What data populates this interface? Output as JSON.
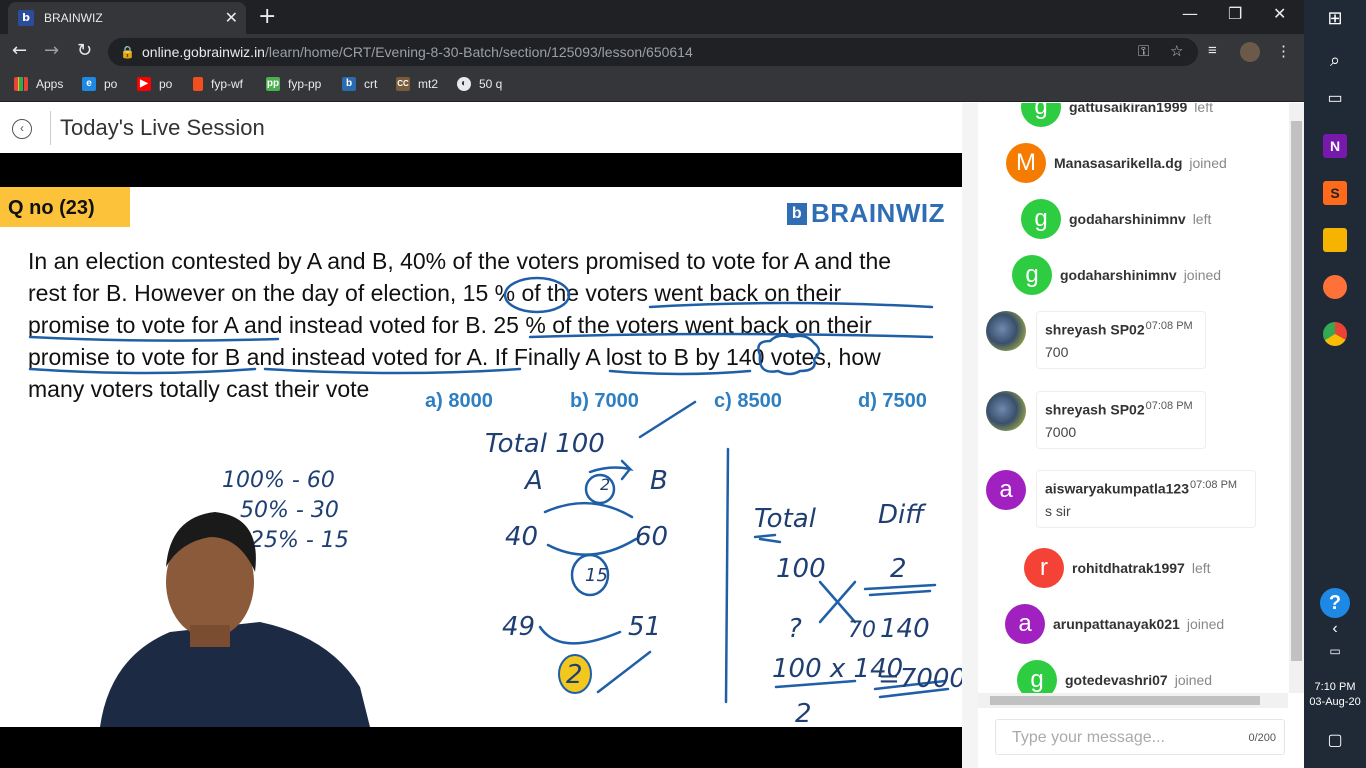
{
  "browser": {
    "tab_title": "BRAINWIZ",
    "tab_favicon": "b",
    "url_domain": "online.gobrainwiz.in",
    "url_path": "/learn/home/CRT/Evening-8-30-Batch/section/125093/lesson/650614"
  },
  "bookmarks": [
    {
      "label": "Apps",
      "icon": "apps-grid-icon",
      "color": "#e8eaed"
    },
    {
      "label": "po",
      "icon": "edge-icon",
      "color": "#1e88e5"
    },
    {
      "label": "po",
      "icon": "youtube-icon",
      "color": "#ff0000"
    },
    {
      "label": "fyp-wf",
      "icon": "figma-icon",
      "color": "#f24e1e"
    },
    {
      "label": "fyp-pp",
      "icon": "pp-icon",
      "color": "#4caf50"
    },
    {
      "label": "crt",
      "icon": "brainwiz-icon",
      "color": "#2b6cb0"
    },
    {
      "label": "mt2",
      "icon": "cc-icon",
      "color": "#7a5c3b"
    },
    {
      "label": "50 q",
      "icon": "globe-icon",
      "color": "#e8eaed"
    }
  ],
  "page": {
    "title": "Today's Live Session"
  },
  "slide": {
    "qno": "Q no (23)",
    "logo": "BRAINWIZ",
    "question_lines": [
      "In an election contested by A and B, 40% of the voters promised to vote for A and the",
      "rest for B. However on the day of election, 15 % of the voters went back on their",
      "promise to vote for A and instead voted for B. 25 % of the voters went back on their",
      "promise to vote for B and instead voted for A. If Finally A lost to B by 140 votes, how",
      "many voters totally cast their vote"
    ],
    "options": [
      "a) 8000",
      "b) 7000",
      "c) 8500",
      "d) 7500"
    ],
    "option_color": "#2e7fc1"
  },
  "chat": {
    "events": [
      {
        "avatar": "g",
        "name": "gattusaikiran1999",
        "action": "left",
        "color": "#2ecc40"
      },
      {
        "avatar": "M",
        "name": "Manasasarikella.dg",
        "action": "joined",
        "color": "#f57c00"
      },
      {
        "avatar": "g",
        "name": "godaharshinimnv",
        "action": "left",
        "color": "#2ecc40"
      },
      {
        "avatar": "g",
        "name": "godaharshinimnv",
        "action": "joined",
        "color": "#2ecc40"
      }
    ],
    "messages": [
      {
        "user": "shreyash SP02",
        "time": "07:08 PM",
        "text": "700"
      },
      {
        "user": "shreyash SP02",
        "time": "07:08 PM",
        "text": "7000"
      },
      {
        "user": "aiswaryakumpatla123",
        "time": "07:08 PM",
        "text": "s sir",
        "avatar": "a",
        "color": "#a020c0"
      }
    ],
    "events2": [
      {
        "avatar": "r",
        "name": "rohitdhatrak1997",
        "action": "left",
        "color": "#f44336"
      },
      {
        "avatar": "a",
        "name": "arunpattanayak021",
        "action": "joined",
        "color": "#a020c0"
      },
      {
        "avatar": "g",
        "name": "gotedevashri07",
        "action": "joined",
        "color": "#2ecc40"
      }
    ],
    "input_placeholder": "Type your message...",
    "char_count": "0/200"
  },
  "taskbar": {
    "time": "7:10 PM",
    "date": "03-Aug-20"
  }
}
